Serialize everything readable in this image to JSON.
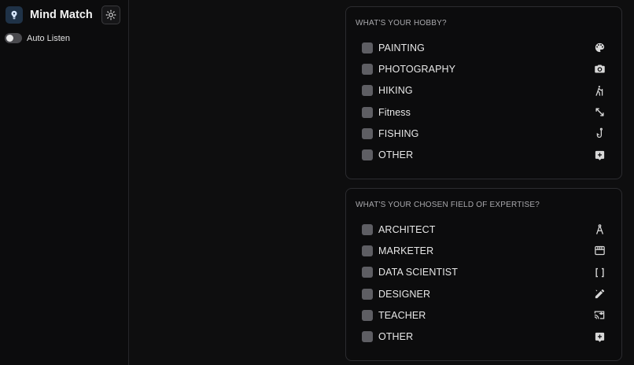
{
  "app": {
    "title": "Mind Match"
  },
  "sidebar": {
    "auto_listen": {
      "label": "Auto Listen",
      "enabled": false
    }
  },
  "hobby": {
    "title": "WHAT'S YOUR HOBBY?",
    "options": [
      {
        "label": "PAINTING",
        "icon": "palette-icon",
        "checked": false
      },
      {
        "label": "PHOTOGRAPHY",
        "icon": "camera-icon",
        "checked": false
      },
      {
        "label": "HIKING",
        "icon": "hiking-icon",
        "checked": false
      },
      {
        "label": "Fitness",
        "icon": "expand-arrows-icon",
        "checked": false
      },
      {
        "label": "FISHING",
        "icon": "fishing-hook-icon",
        "checked": false
      },
      {
        "label": "OTHER",
        "icon": "add-box-icon",
        "checked": false
      }
    ]
  },
  "expertise": {
    "title": "WHAT'S YOUR CHOSEN FIELD OF EXPERTISE?",
    "options": [
      {
        "label": "ARCHITECT",
        "icon": "compass-icon",
        "checked": false
      },
      {
        "label": "MARKETER",
        "icon": "storefront-icon",
        "checked": false
      },
      {
        "label": "DATA SCIENTIST",
        "icon": "brackets-icon",
        "checked": false
      },
      {
        "label": "DESIGNER",
        "icon": "design-pen-icon",
        "checked": false
      },
      {
        "label": "TEACHER",
        "icon": "cast-for-education-icon",
        "checked": false
      },
      {
        "label": "OTHER",
        "icon": "add-box-icon",
        "checked": false
      }
    ]
  },
  "colors": {
    "background": "#0e0e0f",
    "card_border": "#2c2c30",
    "checkbox": "#5e5e63",
    "logo_bg": "#1f3247"
  }
}
